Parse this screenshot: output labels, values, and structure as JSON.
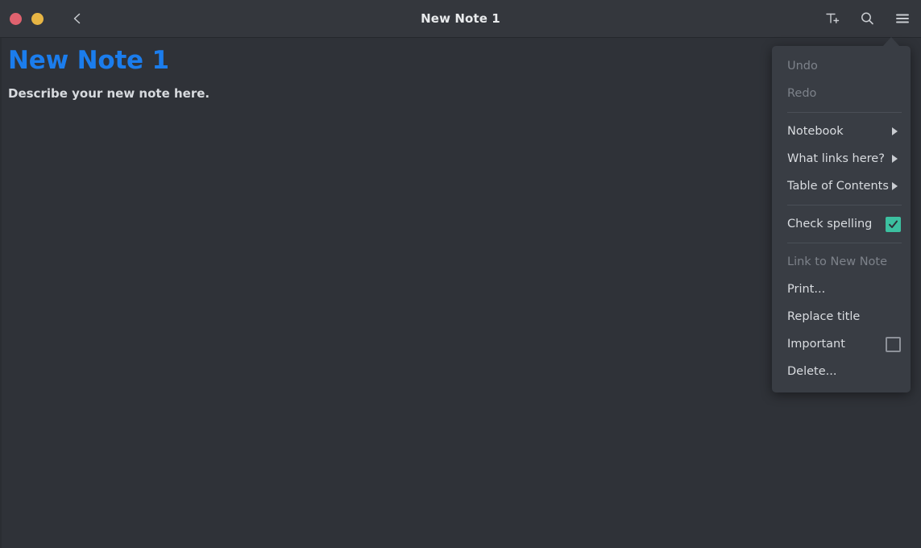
{
  "window": {
    "title": "New Note 1",
    "controls": [
      {
        "name": "close",
        "color": "#e0626f"
      },
      {
        "name": "minimize-maximize",
        "color": "#e7b544"
      }
    ],
    "back_icon": "chevron-left-icon",
    "toolbar_icons": [
      {
        "name": "insert-text-icon",
        "glyph": "T+"
      },
      {
        "name": "search-icon",
        "glyph": "magnifier"
      },
      {
        "name": "menu-icon",
        "glyph": "hamburger"
      }
    ]
  },
  "note": {
    "heading": "New Note 1",
    "body": "Describe your new note here."
  },
  "menu": {
    "items": [
      {
        "label": "Undo",
        "type": "action",
        "disabled": true
      },
      {
        "label": "Redo",
        "type": "action",
        "disabled": true
      },
      {
        "type": "separator"
      },
      {
        "label": "Notebook",
        "type": "submenu",
        "disabled": false
      },
      {
        "label": "What links here?",
        "type": "submenu",
        "disabled": false
      },
      {
        "label": "Table of Contents",
        "type": "submenu",
        "disabled": false
      },
      {
        "type": "separator"
      },
      {
        "label": "Check spelling",
        "type": "checkbox",
        "checked": true,
        "disabled": false
      },
      {
        "type": "separator"
      },
      {
        "label": "Link to New Note",
        "type": "action",
        "disabled": true
      },
      {
        "label": "Print...",
        "type": "action",
        "disabled": false
      },
      {
        "label": "Replace title",
        "type": "action",
        "disabled": false
      },
      {
        "label": "Important",
        "type": "checkbox",
        "checked": false,
        "disabled": false
      },
      {
        "label": "Delete...",
        "type": "action",
        "disabled": false
      }
    ]
  },
  "colors": {
    "titlebar_bg": "#34373d",
    "body_bg": "#2f3238",
    "menu_bg": "#393d44",
    "heading_blue": "#1b7ded",
    "checkbox_on": "#3cc0a0",
    "text": "#d9dce0",
    "text_disabled": "#7d828a"
  }
}
